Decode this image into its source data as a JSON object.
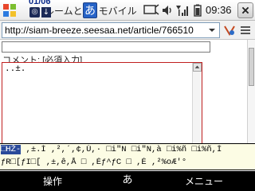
{
  "titlebar": {
    "date": "01/06",
    "title": "ルームとPC モバイル",
    "ime_char": "あ",
    "clock": "09:36"
  },
  "address_bar": {
    "url": "http://siam-breeze.seesaa.net/article/766510"
  },
  "page": {
    "comment_label": "コメント: [必須入力]",
    "comment_value": "..±."
  },
  "candidate_bar": {
    "row1_selected": "□HŽ-",
    "row1_rest": " ,±.Ì  ,²,´,¢,Ù,· □i\"N  □i\"N,à  □i%ñ  □i%ñ,Ì",
    "row2": "ƒR□[ƒI□[  ,±,ê,Å  □ ,Éƒ^ƒC   □ ,É  ,²%oÆ'°"
  },
  "softkeys": {
    "left": "操作",
    "center": "あ",
    "right": "メニュー"
  },
  "colors": {
    "titlebar_bg": "#f0f0f0",
    "ime_blue": "#2663c7",
    "comment_border": "#c02020",
    "candidate_bg": "#fcfce4",
    "softkey_bg": "#000000"
  }
}
